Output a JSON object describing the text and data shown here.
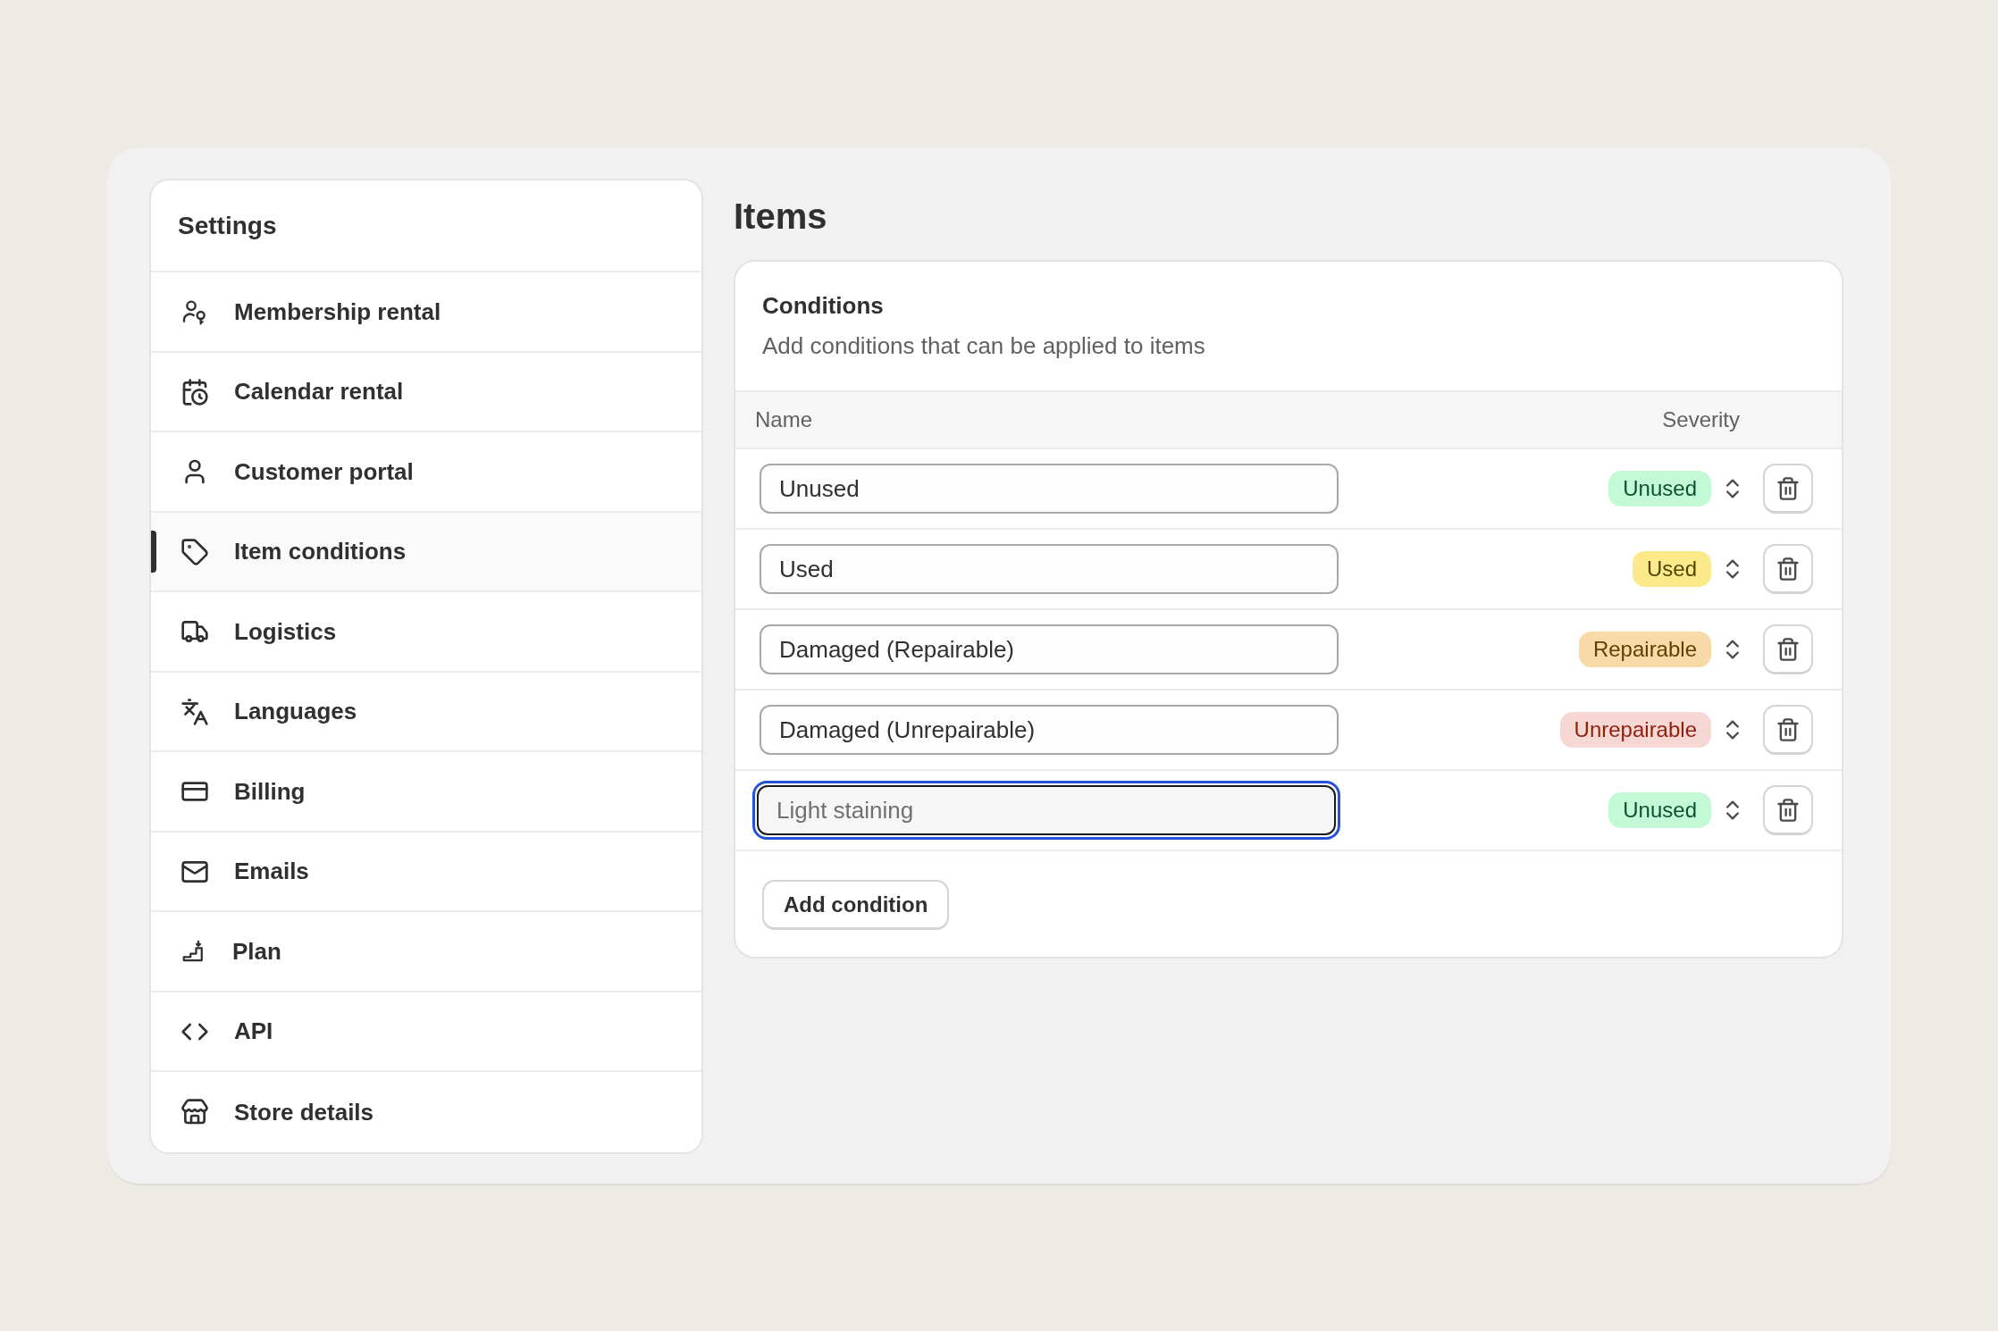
{
  "sidebar": {
    "title": "Settings",
    "items": [
      {
        "label": "Membership rental",
        "selected": false
      },
      {
        "label": "Calendar rental",
        "selected": false
      },
      {
        "label": "Customer portal",
        "selected": false
      },
      {
        "label": "Item conditions",
        "selected": true
      },
      {
        "label": "Logistics",
        "selected": false
      },
      {
        "label": "Languages",
        "selected": false
      },
      {
        "label": "Billing",
        "selected": false
      },
      {
        "label": "Emails",
        "selected": false
      },
      {
        "label": "Plan",
        "selected": false
      },
      {
        "label": "API",
        "selected": false
      },
      {
        "label": "Store details",
        "selected": false
      }
    ]
  },
  "page_title": "Items",
  "conditions": {
    "title": "Conditions",
    "description": "Add conditions that can be applied to items",
    "columns": [
      "Name",
      "Severity"
    ],
    "rows": [
      {
        "value": "Unused",
        "focused": false,
        "severity": {
          "label": "Unused",
          "kind": "unused"
        }
      },
      {
        "value": "Used",
        "focused": false,
        "severity": {
          "label": "Used",
          "kind": "used"
        }
      },
      {
        "value": "Damaged (Repairable)",
        "focused": false,
        "severity": {
          "label": "Repairable",
          "kind": "repairable"
        }
      },
      {
        "value": "Damaged (Unrepairable)",
        "focused": false,
        "severity": {
          "label": "Unrepairable",
          "kind": "unrepairable"
        }
      },
      {
        "placeholder": "Light staining",
        "focused": true,
        "severity": {
          "label": "Unused",
          "kind": "unused"
        }
      }
    ],
    "add_button": "Add condition"
  }
}
